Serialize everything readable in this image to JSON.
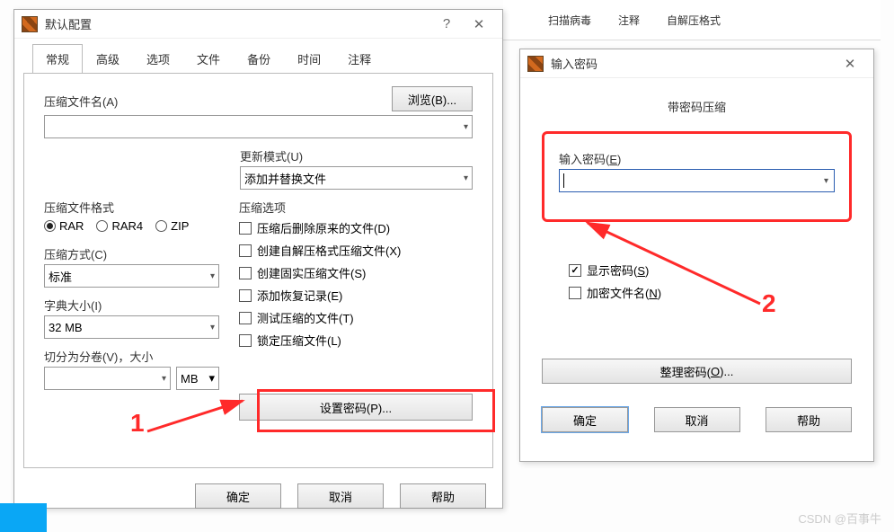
{
  "toolbar": {
    "scan": "扫描病毒",
    "comment": "注释",
    "sfx": "自解压格式"
  },
  "dialog1": {
    "title": "默认配置",
    "tabs": [
      "常规",
      "高级",
      "选项",
      "文件",
      "备份",
      "时间",
      "注释"
    ],
    "activeTab": 0,
    "archiveNameLabel": "压缩文件名(A)",
    "browseBtn": "浏览(B)...",
    "updateModeLabel": "更新模式(U)",
    "updateModeValue": "添加并替换文件",
    "formatLabel": "压缩文件格式",
    "formats": [
      "RAR",
      "RAR4",
      "ZIP"
    ],
    "formatSelected": "RAR",
    "methodLabel": "压缩方式(C)",
    "methodValue": "标准",
    "dictLabel": "字典大小(I)",
    "dictValue": "32 MB",
    "splitLabel": "切分为分卷(V)，大小",
    "splitUnit": "MB",
    "optsLabel": "压缩选项",
    "opts": [
      "压缩后删除原来的文件(D)",
      "创建自解压格式压缩文件(X)",
      "创建固实压缩文件(S)",
      "添加恢复记录(E)",
      "测试压缩的文件(T)",
      "锁定压缩文件(L)"
    ],
    "setPasswordBtn": "设置密码(P)...",
    "ok": "确定",
    "cancel": "取消",
    "help": "帮助"
  },
  "dialog2": {
    "title": "输入密码",
    "subtitle": "带密码压缩",
    "enterPwLabelPrefix": "输入密码(",
    "enterPwLabelU": "E",
    "enterPwLabelSuffix": ")",
    "showPwPrefix": "显示密码(",
    "showPwU": "S",
    "showPwSuffix": ")",
    "encNamesPrefix": "加密文件名(",
    "encNamesU": "N",
    "encNamesSuffix": ")",
    "showPwChecked": true,
    "encNamesChecked": false,
    "organizeBtnPrefix": "整理密码(",
    "organizeBtnU": "O",
    "organizeBtnSuffix": ")...",
    "ok": "确定",
    "cancel": "取消",
    "help": "帮助"
  },
  "annot": {
    "n1": "1",
    "n2": "2"
  },
  "watermark": "CSDN @百事牛"
}
